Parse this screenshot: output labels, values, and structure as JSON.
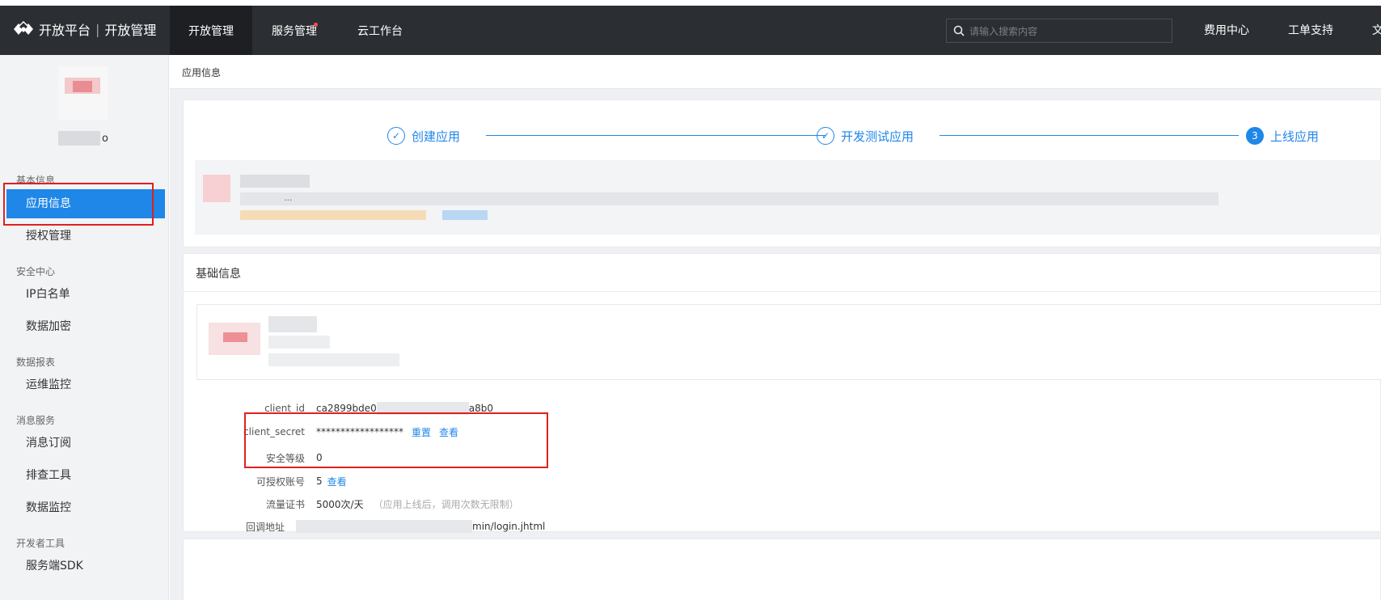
{
  "header": {
    "logo_text": "开放平台",
    "logo_sub": "开放管理",
    "tabs": [
      {
        "label": "开放管理",
        "active": true
      },
      {
        "label": "服务管理",
        "badge": true
      },
      {
        "label": "云工作台"
      }
    ],
    "search_placeholder": "请输入搜索内容",
    "links": [
      "费用中心",
      "工单支持",
      "文"
    ]
  },
  "sidebar": {
    "user_tail": "o",
    "sections": [
      {
        "title": "基本信息",
        "items": [
          {
            "label": "应用信息",
            "active": true
          },
          {
            "label": "授权管理"
          }
        ]
      },
      {
        "title": "安全中心",
        "items": [
          {
            "label": "IP白名单"
          },
          {
            "label": "数据加密"
          }
        ]
      },
      {
        "title": "数据报表",
        "items": [
          {
            "label": "运维监控"
          }
        ]
      },
      {
        "title": "消息服务",
        "items": [
          {
            "label": "消息订阅"
          },
          {
            "label": "排查工具"
          },
          {
            "label": "数据监控"
          }
        ]
      },
      {
        "title": "开发者工具",
        "items": [
          {
            "label": "服务端SDK"
          }
        ]
      }
    ]
  },
  "main": {
    "page_title": "应用信息",
    "steps": [
      {
        "label": "创建应用",
        "state": "done",
        "icon": "check-icon"
      },
      {
        "label": "开发测试应用",
        "state": "done",
        "icon": "check-icon"
      },
      {
        "label": "上线应用",
        "state": "current",
        "number": "3"
      }
    ],
    "app_strip_ellipsis": "...",
    "basic_title": "基础信息",
    "fields": {
      "client_id_label": "client_id",
      "client_id_prefix": "ca2899bde0",
      "client_id_suffix": "a8b0",
      "client_secret_label": "client_secret",
      "client_secret_value": "******************",
      "reset_link": "重置",
      "view_link": "查看",
      "security_label": "安全等级",
      "security_value": "0",
      "accounts_label": "可授权账号",
      "accounts_value": "5",
      "accounts_link": "查看",
      "traffic_label": "流量证书",
      "traffic_value": "5000次/天",
      "traffic_note": "（应用上线后，调用次数无限制）",
      "callback_label": "回调地址",
      "callback_suffix": "min/login.jhtml"
    }
  },
  "colors": {
    "accent": "#1f87e8",
    "topbar": "#2b2e33",
    "highlight_box": "#e02020"
  }
}
